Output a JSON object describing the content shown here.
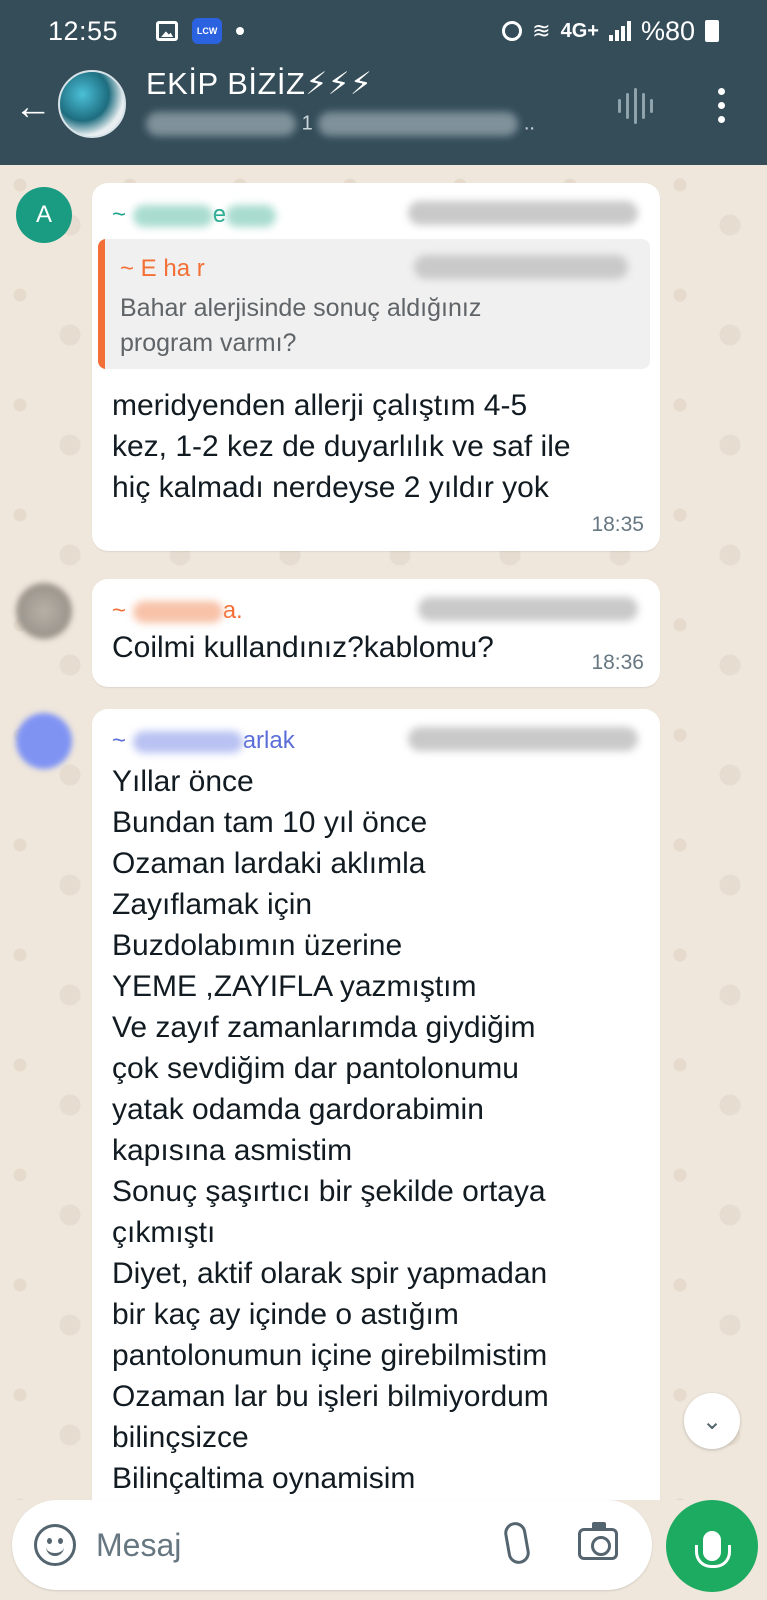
{
  "status_bar": {
    "time": "12:55",
    "app_badge": "LCW",
    "network": "4G+",
    "battery": "%80"
  },
  "header": {
    "title": "EKİP BİZİZ⚡⚡⚡",
    "subtitle_fragment": "1",
    "subtitle_ellipsis": ".."
  },
  "messages": [
    {
      "avatar_letter": "A",
      "sender_suffix": "e",
      "quote": {
        "author_visible": "~ E     ha     r",
        "text": "Bahar alerjisinde sonuç aldığınız program varmı?"
      },
      "text_lines": [
        "meridyenden allerji çalıştım 4-5",
        "kez, 1-2 kez de duyarlılık ve saf ile",
        "hiç kalmadı nerdeyse 2 yıldır yok"
      ],
      "time": "18:35"
    },
    {
      "sender_suffix": "a.",
      "text_lines": [
        "Coilmi kullandınız?kablomu?"
      ],
      "time": "18:36"
    },
    {
      "sender_suffix": "arlak",
      "text_lines": [
        "Yıllar önce",
        "Bundan tam 10 yıl önce",
        "Ozaman lardaki aklımla",
        "Zayıflamak için",
        "Buzdolabımın üzerine",
        "YEME ,ZAYIFLA yazmıştım",
        "Ve zayıf zamanlarımda giydiğim",
        "çok sevdiğim dar pantolonumu",
        "yatak odamda gardorabimin",
        "kapısına asmistim",
        "Sonuç şaşırtıcı bir şekilde ortaya",
        "çıkmıştı",
        "Diyet, aktif olarak spir yapmadan",
        "bir kaç ay içinde o astığım",
        "pantolonumun içine girebilmistim",
        "Ozaman lar bu işleri bilmiyordum",
        "bilinçsizce",
        "Bilinçaltima oynamisim"
      ]
    }
  ],
  "input": {
    "placeholder": "Mesaj"
  },
  "icons": {
    "back": "back-arrow-icon",
    "voice_call": "voice-wave-icon",
    "more": "more-vertical-icon",
    "emoji": "emoji-icon",
    "attach": "paperclip-icon",
    "camera": "camera-icon",
    "mic": "mic-icon",
    "scroll_down": "double-chevron-down-icon"
  },
  "colors": {
    "header_bg": "#344d59",
    "chat_bg": "#efe7dc",
    "bubble_bg": "#ffffff",
    "sender_1": "#1aa58a",
    "sender_2": "#f36f35",
    "sender_3": "#5a6dd8",
    "mic_button": "#1daa61"
  }
}
